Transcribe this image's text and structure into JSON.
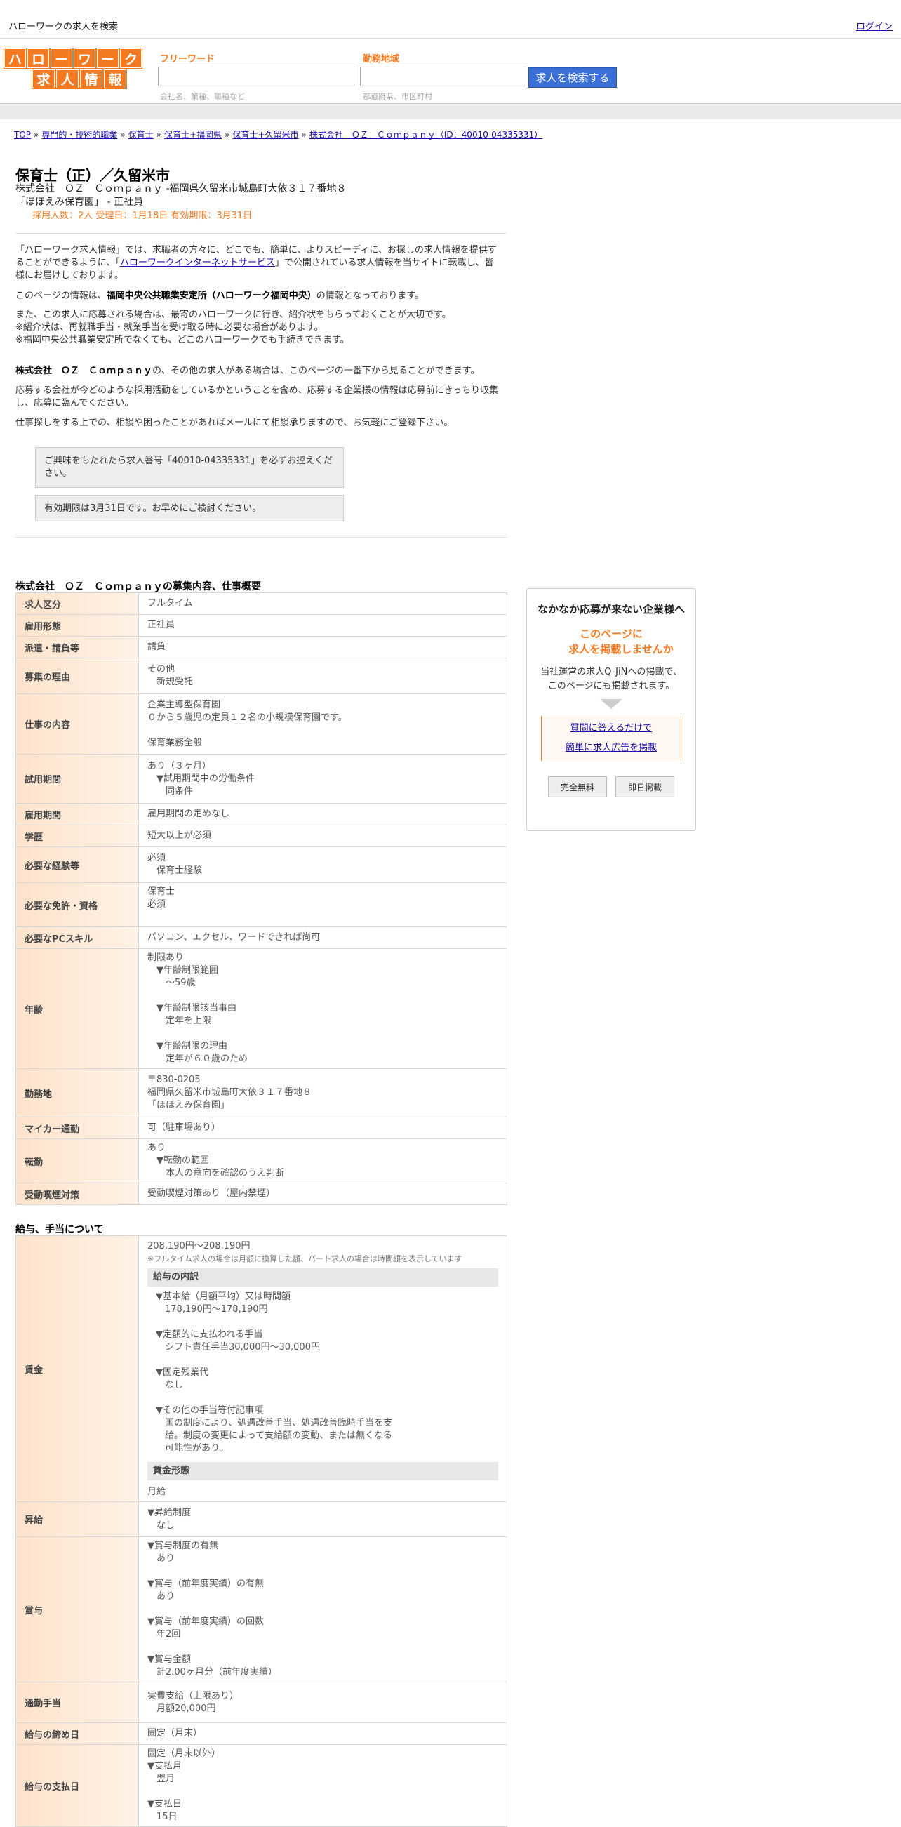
{
  "topbar": {
    "title": "ハローワークの求人を検索",
    "login": "ログイン"
  },
  "logo": {
    "row1": [
      "ハ",
      "ロ",
      "ー",
      "ワ",
      "ー",
      "ク"
    ],
    "row2": [
      "求",
      "人",
      "情",
      "報"
    ]
  },
  "search": {
    "freeword_label": "フリーワード",
    "freeword_hint": "会社名、業種、職種など",
    "area_label": "勤務地域",
    "area_hint": "都道府県、市区町村",
    "button": "求人を検索する"
  },
  "breadcrumb": [
    "TOP",
    "専門的・技術的職業",
    "保育士",
    "保育士+福岡県",
    "保育士+久留米市",
    "株式会社　ＯＺ　Ｃｏｍｐａｎｙ（ID：40010-04335331）"
  ],
  "job": {
    "title": "保育士（正）／久留米市",
    "company_line": "株式会社　ＯＺ　Ｃｏｍｐａｎｙ -福岡県久留米市城島町大依３１７番地８",
    "place_line": "「ほほえみ保育園」 - 正社員",
    "counts": "採用人数：2人  受理日：1月18日  有効期限：3月31日"
  },
  "intro": {
    "p1a": "「ハローワーク求人情報」では、求職者の方々に、どこでも、簡単に、よりスピーディに、お探しの求人情報を提供することができるように、「",
    "p1link": "ハローワークインターネットサービス",
    "p1b": "」で公開されている求人情報を当サイトに転載し、皆様にお届けしております。",
    "p2a": "このページの情報は、",
    "p2b": "福岡中央公共職業安定所（ハローワーク福岡中央）",
    "p2c": "の情報となっております。",
    "p3": "また、この求人に応募される場合は、最寄のハローワークに行き、紹介状をもらっておくことが大切です。",
    "p3b": "※紹介状は、再就職手当・就業手当を受け取る時に必要な場合があります。",
    "p3c": "※福岡中央公共職業安定所でなくても、どこのハローワークでも手続きできます。",
    "p4a": "株式会社　ＯＺ　Ｃｏｍｐａｎｙ",
    "p4b": "の、その他の求人がある場合は、このページの一番下から見ることができます。",
    "p5": "応募する会社が今どのような採用活動をしているかということを含め、応募する企業様の情報は応募前にきっちり収集し、応募に臨んでください。",
    "p6": "仕事探しをする上での、相談や困ったことがあればメールにて相談承りますので、お気軽にご登録下さい。",
    "note1": "ご興味をもたれたら求人番号「40010-04335331」を必ずお控えください。",
    "note2": "有効期限は3月31日です。お早めにご検討ください。"
  },
  "overview": {
    "heading": "株式会社　ＯＺ　Ｃｏｍｐａｎｙの募集内容、仕事概要",
    "rows": [
      {
        "k": "求人区分",
        "v": [
          "フルタイム"
        ]
      },
      {
        "k": "雇用形態",
        "v": [
          "正社員"
        ]
      },
      {
        "k": "派遣・請負等",
        "v": [
          "請負"
        ]
      },
      {
        "k": "募集の理由",
        "v": [
          "その他",
          "　新規受託"
        ]
      },
      {
        "k": "仕事の内容",
        "v": [
          "企業主導型保育園",
          "０から５歳児の定員１２名の小規模保育園です。",
          "",
          "保育業務全般"
        ]
      },
      {
        "k": "試用期間",
        "v": [
          "あり（３ヶ月）",
          "　▼試用期間中の労働条件",
          "　　同条件"
        ]
      },
      {
        "k": "雇用期間",
        "v": [
          "雇用期間の定めなし"
        ]
      },
      {
        "k": "学歴",
        "v": [
          "短大以上が必須"
        ]
      },
      {
        "k": "必要な経験等",
        "v": [
          "必須",
          "　保育士経験"
        ]
      },
      {
        "k": "必要な免許・資格",
        "v": [
          "保育士",
          "必須",
          ""
        ]
      },
      {
        "k": "必要なPCスキル",
        "v": [
          "パソコン、エクセル、ワードできれば尚可"
        ]
      },
      {
        "k": "年齢",
        "v": [
          "制限あり",
          "　▼年齢制限範囲",
          "　　〜59歳",
          "",
          "　▼年齢制限該当事由",
          "　　定年を上限",
          "",
          "　▼年齢制限の理由",
          "　　定年が６０歳のため"
        ]
      },
      {
        "k": "勤務地",
        "v": [
          "〒830-0205",
          "福岡県久留米市城島町大依３１７番地８",
          "「ほほえみ保育園」"
        ]
      },
      {
        "k": "マイカー通勤",
        "v": [
          "可（駐車場あり）"
        ]
      },
      {
        "k": "転勤",
        "v": [
          "あり",
          "　▼転勤の範囲",
          "　　本人の意向を確認のうえ判断"
        ]
      },
      {
        "k": "受動喫煙対策",
        "v": [
          "受動喫煙対策あり（屋内禁煙）"
        ]
      }
    ]
  },
  "salary": {
    "heading": "給与、手当について",
    "wage_label": "賃金",
    "wage_amount": "208,190円〜208,190円",
    "wage_note": "※フルタイム求人の場合は月額に換算した額、パート求人の場合は時間額を表示しています",
    "breakdown_head": "給与の内訳",
    "breakdown": [
      "▼基本給（月額平均）又は時間額",
      "　178,190円〜178,190円",
      "",
      "▼定額的に支払われる手当",
      "　シフト責任手当30,000円〜30,000円",
      "",
      "▼固定残業代",
      "　なし",
      "",
      "▼その他の手当等付記事項",
      "　国の制度により、処遇改善手当、処遇改善臨時手当を支",
      "　給。制度の変更によって支給額の変動、または無くなる",
      "　可能性があり。"
    ],
    "form_head": "賃金形態",
    "form_value": "月給",
    "rows": [
      {
        "k": "昇給",
        "v": [
          "▼昇給制度",
          "　なし"
        ]
      },
      {
        "k": "賞与",
        "v": [
          "▼賞与制度の有無",
          "　あり",
          "",
          "▼賞与（前年度実績）の有無",
          "　あり",
          "",
          "▼賞与（前年度実績）の回数",
          "　年2回",
          "",
          "▼賞与金額",
          "　計2.00ヶ月分（前年度実績）"
        ]
      },
      {
        "k": "通勤手当",
        "v": [
          "実費支給（上限あり）",
          "　月額20,000円"
        ]
      },
      {
        "k": "給与の締め日",
        "v": [
          "固定（月末）"
        ]
      },
      {
        "k": "給与の支払日",
        "v": [
          "固定（月末以外）",
          "▼支払月",
          "　翌月",
          "",
          "▼支払日",
          "　15日"
        ]
      }
    ]
  },
  "ad": {
    "h1": "なかなか応募が来ない企業様へ",
    "h2a": "このページに",
    "h2b": "求人を掲載しませんか",
    "p1": "当社運営の求人Q-JiNへの掲載で、",
    "p2": "このページにも掲載されます。",
    "link1": "質問に答えるだけで",
    "link2": "簡単に求人広告を掲載",
    "btn1": "完全無料",
    "btn2": "即日掲載"
  }
}
